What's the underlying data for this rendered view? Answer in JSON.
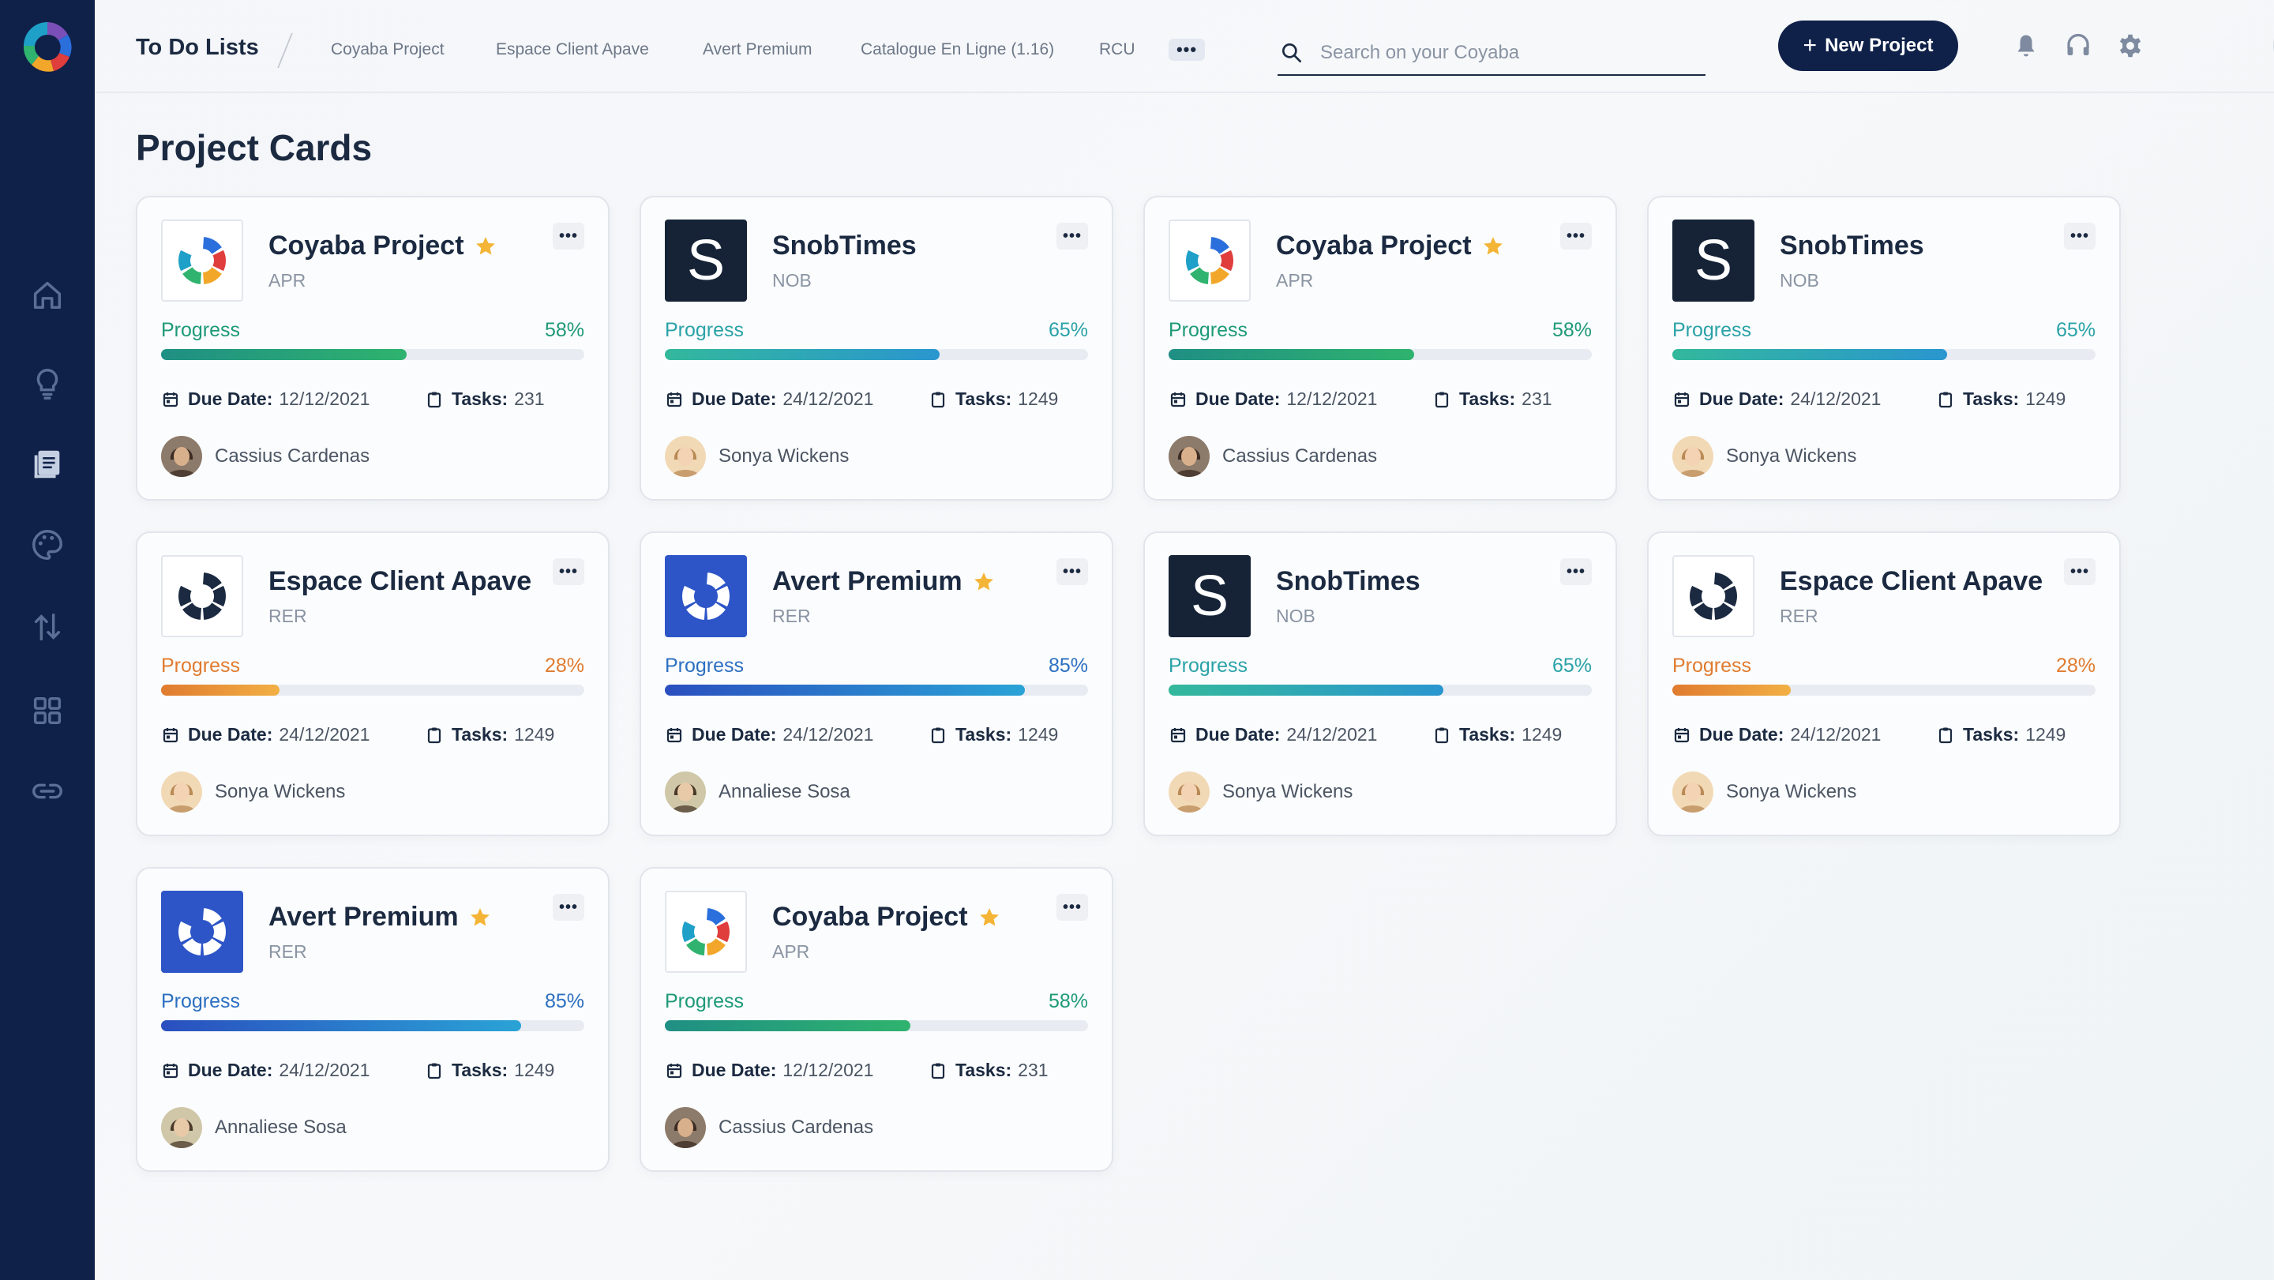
{
  "topbar": {
    "title": "To Do Lists",
    "breadcrumbs": [
      "Coyaba Project",
      "Espace Client Apave",
      "Avert Premium",
      "Catalogue En Ligne (1.16)",
      "RCU"
    ],
    "more_label": "•••",
    "search_placeholder": "Search on your Coyaba",
    "new_project_label": "New Project",
    "new_project_icon": "+"
  },
  "sidebar": {
    "items": [
      "home-icon",
      "lightbulb-icon",
      "document-list-icon",
      "palette-icon",
      "transfer-icon",
      "grid-icon",
      "link-icon"
    ]
  },
  "page": {
    "title": "Project Cards"
  },
  "labels": {
    "progress": "Progress",
    "due_date": "Due Date:",
    "tasks": "Tasks:",
    "menu_dots": "•••",
    "s_letter": "S"
  },
  "colors": {
    "sidebar": "#0f2149",
    "green": "#1e9a78",
    "teal": "#2aa2a8",
    "orange": "#e07b2f",
    "blue": "#2c6fc1",
    "star": "#f4b537"
  },
  "cards": [
    {
      "name": "Coyaba Project",
      "code": "APR",
      "starred": true,
      "logo": "coyaba-colorful",
      "progress": 58,
      "progress_text": "58%",
      "due": "12/12/2021",
      "tasks": "231",
      "owner": "Cassius Cardenas",
      "theme": "green"
    },
    {
      "name": "SnobTimes",
      "code": "NOB",
      "starred": false,
      "logo": "letter-s",
      "progress": 65,
      "progress_text": "65%",
      "due": "24/12/2021",
      "tasks": "1249",
      "owner": "Sonya Wickens",
      "theme": "teal"
    },
    {
      "name": "Coyaba Project",
      "code": "APR",
      "starred": true,
      "logo": "coyaba-colorful",
      "progress": 58,
      "progress_text": "58%",
      "due": "12/12/2021",
      "tasks": "231",
      "owner": "Cassius Cardenas",
      "theme": "green"
    },
    {
      "name": "SnobTimes",
      "code": "NOB",
      "starred": false,
      "logo": "letter-s",
      "progress": 65,
      "progress_text": "65%",
      "due": "24/12/2021",
      "tasks": "1249",
      "owner": "Sonya Wickens",
      "theme": "teal"
    },
    {
      "name": "Espace Client Apave",
      "code": "RER",
      "starred": false,
      "logo": "coyaba-dark",
      "progress": 28,
      "progress_text": "28%",
      "due": "24/12/2021",
      "tasks": "1249",
      "owner": "Sonya Wickens",
      "theme": "orange"
    },
    {
      "name": "Avert Premium",
      "code": "RER",
      "starred": true,
      "logo": "coyaba-blue",
      "progress": 85,
      "progress_text": "85%",
      "due": "24/12/2021",
      "tasks": "1249",
      "owner": "Annaliese Sosa",
      "theme": "blue"
    },
    {
      "name": "SnobTimes",
      "code": "NOB",
      "starred": false,
      "logo": "letter-s",
      "progress": 65,
      "progress_text": "65%",
      "due": "24/12/2021",
      "tasks": "1249",
      "owner": "Sonya Wickens",
      "theme": "teal"
    },
    {
      "name": "Espace Client Apave",
      "code": "RER",
      "starred": false,
      "logo": "coyaba-dark",
      "progress": 28,
      "progress_text": "28%",
      "due": "24/12/2021",
      "tasks": "1249",
      "owner": "Sonya Wickens",
      "theme": "orange"
    },
    {
      "name": "Avert Premium",
      "code": "RER",
      "starred": true,
      "logo": "coyaba-blue",
      "progress": 85,
      "progress_text": "85%",
      "due": "24/12/2021",
      "tasks": "1249",
      "owner": "Annaliese Sosa",
      "theme": "blue"
    },
    {
      "name": "Coyaba Project",
      "code": "APR",
      "starred": true,
      "logo": "coyaba-colorful",
      "progress": 58,
      "progress_text": "58%",
      "due": "12/12/2021",
      "tasks": "231",
      "owner": "Cassius Cardenas",
      "theme": "green"
    }
  ]
}
